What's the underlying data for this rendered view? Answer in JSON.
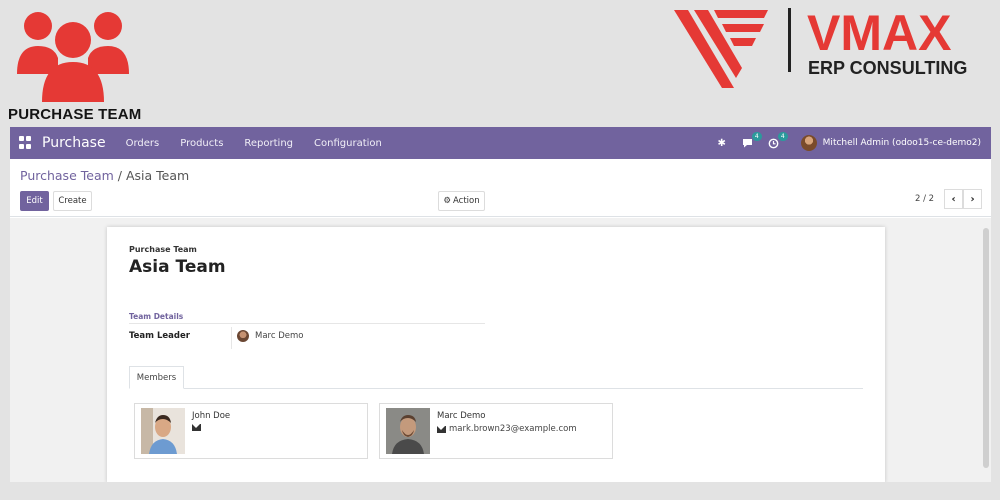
{
  "banner": {
    "title": "PURCHASE TEAM",
    "brand_name": "VMAX",
    "brand_tagline": "ERP CONSULTING",
    "accent_color": "#e53935",
    "logo_icon": "people-group-icon"
  },
  "navbar": {
    "app_name": "Purchase",
    "menu": [
      "Orders",
      "Products",
      "Reporting",
      "Configuration"
    ],
    "messages_count": "4",
    "activities_count": "4",
    "user": "Mitchell Admin (odoo15-ce-demo2)",
    "color": "#71639e"
  },
  "control_panel": {
    "breadcrumb_parent": "Purchase Team",
    "breadcrumb_sep": " / ",
    "breadcrumb_current": "Asia Team",
    "edit_label": "Edit",
    "create_label": "Create",
    "action_label": "Action",
    "pager": "2 / 2"
  },
  "form": {
    "small_label": "Purchase Team",
    "name": "Asia Team",
    "group_title": "Team Details",
    "team_leader_label": "Team Leader",
    "team_leader_value": "Marc Demo",
    "tab_members": "Members",
    "members": [
      {
        "name": "John Doe",
        "email": ""
      },
      {
        "name": "Marc Demo",
        "email": "mark.brown23@example.com"
      }
    ]
  }
}
